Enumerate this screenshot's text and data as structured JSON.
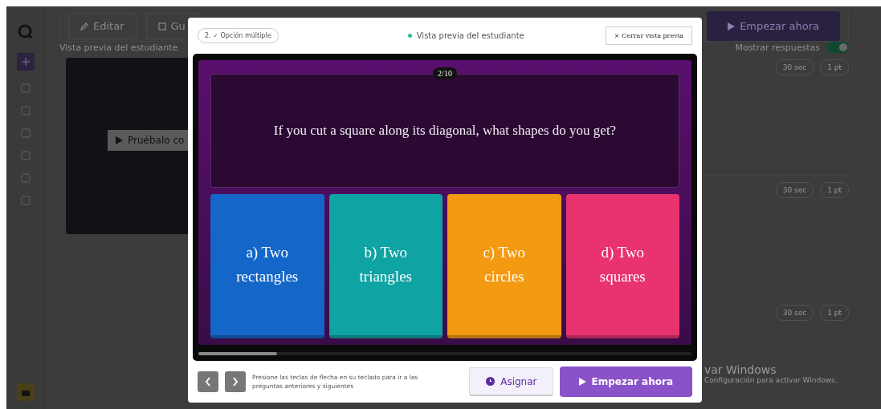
{
  "background_page": {
    "toolbar": {
      "edit_button": "Editar",
      "save_button": "Gu",
      "start_button": "Empezar ahora"
    },
    "section_title": "Vista previa del estudiante",
    "show_answers": {
      "label": "Mostrar respuestas",
      "on": true
    },
    "preview_card": {
      "try_button": "Pruébalo co"
    },
    "questions": [
      {
        "time": "30 sec",
        "points": "1 pt"
      },
      {
        "time": "30 sec",
        "points": "1 pt"
      },
      {
        "time": "30 sec",
        "points": "1 pt"
      }
    ]
  },
  "modal": {
    "question_type": "2. ✓ Opción múltiple",
    "title": "Vista previa del estudiante",
    "close_button": "× Cerrar vista previa",
    "counter": "2/10",
    "question": "If you cut a square along its diagonal, what shapes do you get?",
    "options": [
      {
        "text": "a) Two rectangles",
        "color": "#1466c8"
      },
      {
        "text": "b) Two triangles",
        "color": "#0fa3a3"
      },
      {
        "text": "c) Two circles",
        "color": "#f39a12"
      },
      {
        "text": "d) Two squares",
        "color": "#e8336f"
      }
    ],
    "progress": {
      "level": 0.16
    },
    "hint": "Presione las teclas de flecha en su teclado para ir a las preguntas anteriores y siguientes",
    "assign_button": "Asignar",
    "start_button": "Empezar ahora"
  },
  "os_notice": {
    "title": "var Windows",
    "text": "Configuración para activar Windows."
  }
}
